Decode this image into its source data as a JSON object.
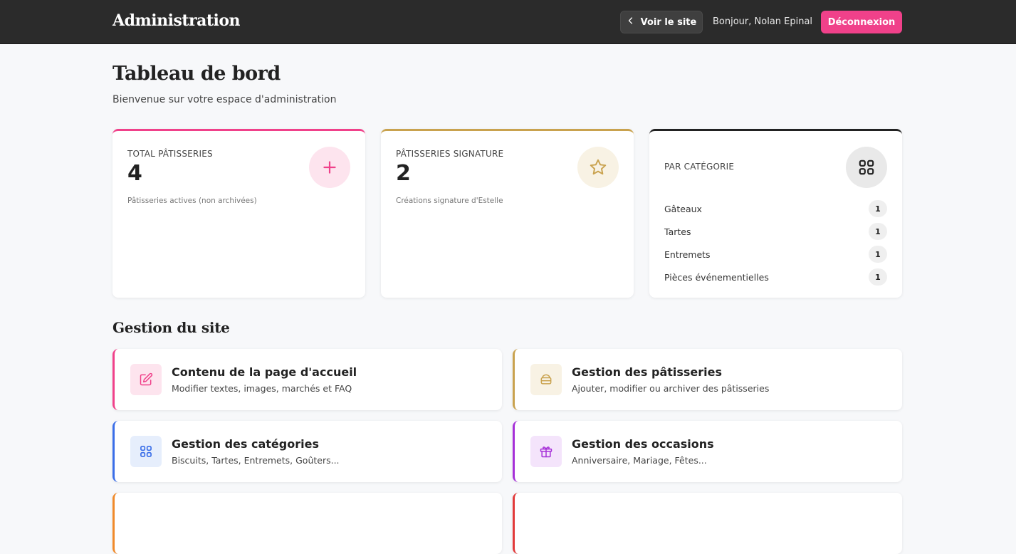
{
  "header": {
    "brand": "Administration",
    "view_site_label": "Voir le site",
    "greeting": "Bonjour, Nolan Epinal",
    "logout_label": "Déconnexion"
  },
  "page": {
    "title": "Tableau de bord",
    "subtitle": "Bienvenue sur votre espace d'administration"
  },
  "stats": {
    "total": {
      "label": "TOTAL PÂTISSERIES",
      "value": "4",
      "note": "Pâtisseries actives (non archivées)",
      "icon": "plus-icon"
    },
    "signature": {
      "label": "PÂTISSERIES SIGNATURE",
      "value": "2",
      "note": "Créations signature d'Estelle",
      "icon": "star-icon"
    },
    "categories": {
      "label": "PAR CATÉGORIE",
      "icon": "grid-icon",
      "items": [
        {
          "name": "Gâteaux",
          "count": "1"
        },
        {
          "name": "Tartes",
          "count": "1"
        },
        {
          "name": "Entremets",
          "count": "1"
        },
        {
          "name": "Pièces événementielles",
          "count": "1"
        }
      ]
    }
  },
  "management": {
    "title": "Gestion du site",
    "items": [
      {
        "title": "Contenu de la page d'accueil",
        "desc": "Modifier textes, images, marchés et FAQ",
        "icon": "edit-icon"
      },
      {
        "title": "Gestion des pâtisseries",
        "desc": "Ajouter, modifier ou archiver des pâtisseries",
        "icon": "cake-icon"
      },
      {
        "title": "Gestion des catégories",
        "desc": "Biscuits, Tartes, Entremets, Goûters...",
        "icon": "grid-icon"
      },
      {
        "title": "Gestion des occasions",
        "desc": "Anniversaire, Mariage, Fêtes...",
        "icon": "gift-icon"
      }
    ]
  },
  "colors": {
    "header_bg": "#2b2b2b",
    "accent_pink": "#f0418a",
    "accent_gold": "#c9a24e",
    "accent_blue": "#3a6ee8",
    "accent_purple": "#a630d8",
    "accent_orange": "#f08a2a",
    "accent_red": "#e23a3a"
  }
}
